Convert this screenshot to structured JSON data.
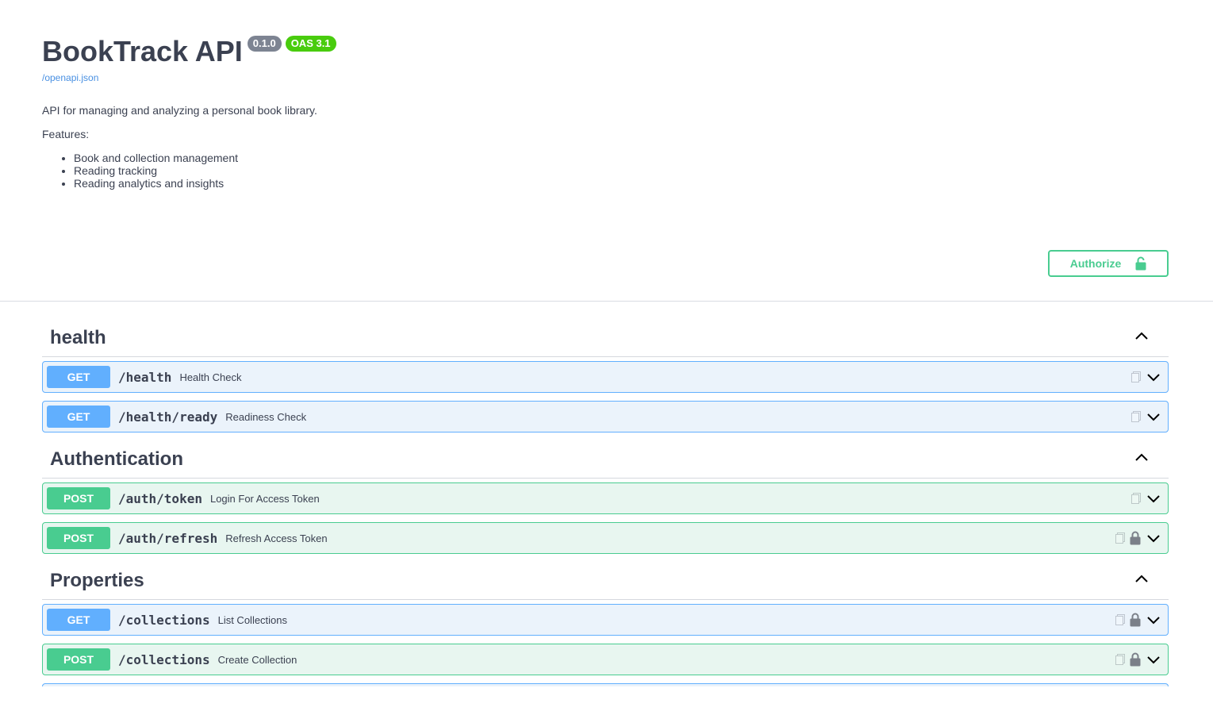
{
  "info": {
    "title": "BookTrack API",
    "version": "0.1.0",
    "oas": "OAS 3.1",
    "spec_link": "/openapi.json",
    "description": "API for managing and analyzing a personal book library.",
    "features_label": "Features:",
    "features": [
      "Book and collection management",
      "Reading tracking",
      "Reading analytics and insights"
    ]
  },
  "authorize": {
    "label": "Authorize"
  },
  "sections": [
    {
      "name": "health",
      "ops": [
        {
          "method": "GET",
          "path": "/health",
          "summary": "Health Check",
          "locked": false
        },
        {
          "method": "GET",
          "path": "/health/ready",
          "summary": "Readiness Check",
          "locked": false
        }
      ]
    },
    {
      "name": "Authentication",
      "ops": [
        {
          "method": "POST",
          "path": "/auth/token",
          "summary": "Login For Access Token",
          "locked": false
        },
        {
          "method": "POST",
          "path": "/auth/refresh",
          "summary": "Refresh Access Token",
          "locked": true
        }
      ]
    },
    {
      "name": "Properties",
      "ops": [
        {
          "method": "GET",
          "path": "/collections",
          "summary": "List Collections",
          "locked": true
        },
        {
          "method": "POST",
          "path": "/collections",
          "summary": "Create Collection",
          "locked": true
        }
      ]
    }
  ],
  "colors": {
    "get": "#61affe",
    "post": "#49cc90",
    "version_badge": "#7d8492",
    "oas_badge": "#49cc0e",
    "link": "#4990e2"
  },
  "icons": {
    "copy": "copy-icon",
    "lock": "lock-icon",
    "expand": "chevron-down-icon",
    "collapse": "chevron-up-icon"
  }
}
